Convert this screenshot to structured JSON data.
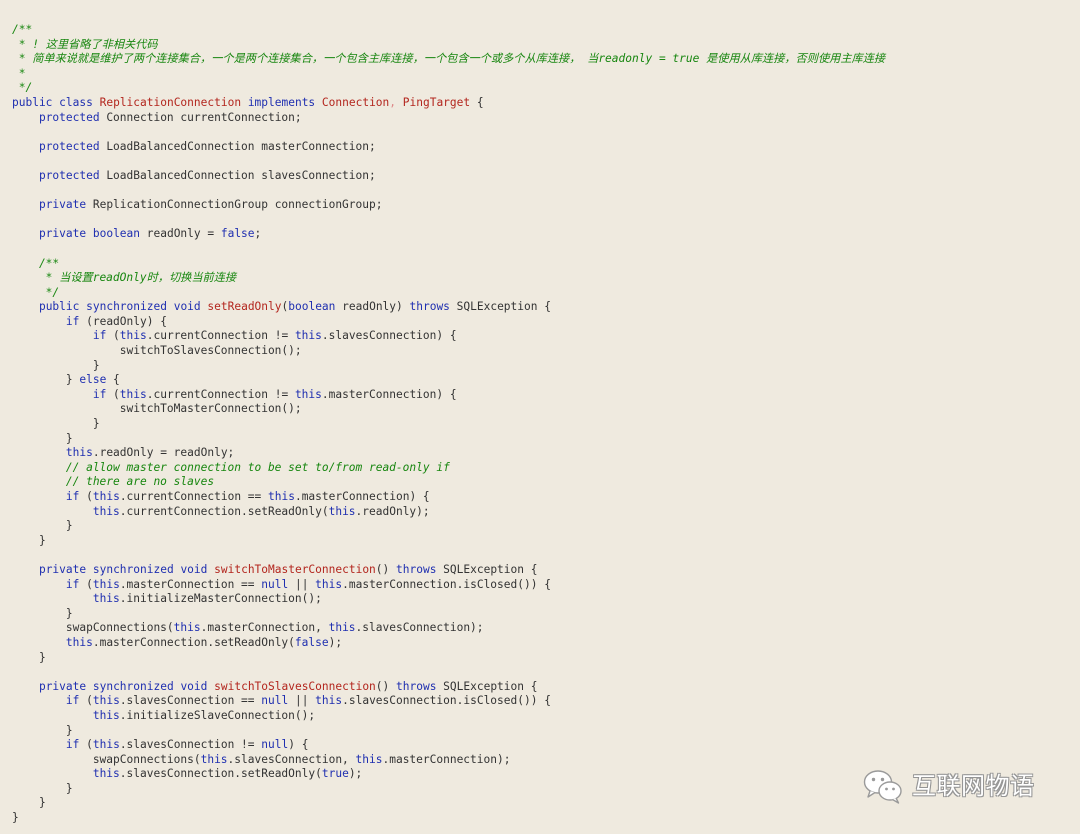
{
  "code": {
    "language": "java",
    "lines": [
      [
        {
          "t": "/**",
          "c": "comment"
        }
      ],
      [
        {
          "t": " * ! 这里省略了非相关代码",
          "c": "comment"
        }
      ],
      [
        {
          "t": " * 简单来说就是维护了两个连接集合，一个是两个连接集合，一个包含主库连接，一个包含一个或多个从库连接， 当readonly = true 是使用从库连接，否则使用主库连接",
          "c": "comment"
        }
      ],
      [
        {
          "t": " *",
          "c": "comment"
        }
      ],
      [
        {
          "t": " */",
          "c": "comment"
        }
      ],
      [
        {
          "t": "public",
          "c": "kw"
        },
        {
          "t": " ",
          "c": "plain"
        },
        {
          "t": "class",
          "c": "kw"
        },
        {
          "t": " ",
          "c": "plain"
        },
        {
          "t": "ReplicationConnection",
          "c": "cls"
        },
        {
          "t": " ",
          "c": "plain"
        },
        {
          "t": "implements",
          "c": "kw"
        },
        {
          "t": " ",
          "c": "plain"
        },
        {
          "t": "Connection",
          "c": "cls"
        },
        {
          "t": ", ",
          "c": "op"
        },
        {
          "t": "PingTarget",
          "c": "cls"
        },
        {
          "t": " {",
          "c": "plain"
        }
      ],
      [
        {
          "t": "    ",
          "c": "plain"
        },
        {
          "t": "protected",
          "c": "kw"
        },
        {
          "t": " Connection currentConnection;",
          "c": "plain"
        }
      ],
      [
        {
          "t": "",
          "c": "plain"
        }
      ],
      [
        {
          "t": "    ",
          "c": "plain"
        },
        {
          "t": "protected",
          "c": "kw"
        },
        {
          "t": " LoadBalancedConnection masterConnection;",
          "c": "plain"
        }
      ],
      [
        {
          "t": "",
          "c": "plain"
        }
      ],
      [
        {
          "t": "    ",
          "c": "plain"
        },
        {
          "t": "protected",
          "c": "kw"
        },
        {
          "t": " LoadBalancedConnection slavesConnection;",
          "c": "plain"
        }
      ],
      [
        {
          "t": "",
          "c": "plain"
        }
      ],
      [
        {
          "t": "    ",
          "c": "plain"
        },
        {
          "t": "private",
          "c": "kw"
        },
        {
          "t": " ReplicationConnectionGroup connectionGroup;",
          "c": "plain"
        }
      ],
      [
        {
          "t": "",
          "c": "plain"
        }
      ],
      [
        {
          "t": "    ",
          "c": "plain"
        },
        {
          "t": "private",
          "c": "kw"
        },
        {
          "t": " ",
          "c": "plain"
        },
        {
          "t": "boolean",
          "c": "type"
        },
        {
          "t": " readOnly = ",
          "c": "plain"
        },
        {
          "t": "false",
          "c": "kw"
        },
        {
          "t": ";",
          "c": "plain"
        }
      ],
      [
        {
          "t": "",
          "c": "plain"
        }
      ],
      [
        {
          "t": "    /**",
          "c": "comment"
        }
      ],
      [
        {
          "t": "     * 当设置readOnly时，切换当前连接",
          "c": "comment"
        }
      ],
      [
        {
          "t": "     */",
          "c": "comment"
        }
      ],
      [
        {
          "t": "    ",
          "c": "plain"
        },
        {
          "t": "public",
          "c": "kw"
        },
        {
          "t": " ",
          "c": "plain"
        },
        {
          "t": "synchronized",
          "c": "kw"
        },
        {
          "t": " ",
          "c": "plain"
        },
        {
          "t": "void",
          "c": "type"
        },
        {
          "t": " ",
          "c": "plain"
        },
        {
          "t": "setReadOnly",
          "c": "fn"
        },
        {
          "t": "(",
          "c": "plain"
        },
        {
          "t": "boolean",
          "c": "type"
        },
        {
          "t": " readOnly) ",
          "c": "plain"
        },
        {
          "t": "throws",
          "c": "kw"
        },
        {
          "t": " SQLException {",
          "c": "plain"
        }
      ],
      [
        {
          "t": "        ",
          "c": "plain"
        },
        {
          "t": "if",
          "c": "kw"
        },
        {
          "t": " (readOnly) {",
          "c": "plain"
        }
      ],
      [
        {
          "t": "            ",
          "c": "plain"
        },
        {
          "t": "if",
          "c": "kw"
        },
        {
          "t": " (",
          "c": "plain"
        },
        {
          "t": "this",
          "c": "kw"
        },
        {
          "t": ".currentConnection != ",
          "c": "plain"
        },
        {
          "t": "this",
          "c": "kw"
        },
        {
          "t": ".slavesConnection) {",
          "c": "plain"
        }
      ],
      [
        {
          "t": "                switchToSlavesConnection();",
          "c": "plain"
        }
      ],
      [
        {
          "t": "            }",
          "c": "plain"
        }
      ],
      [
        {
          "t": "        } ",
          "c": "plain"
        },
        {
          "t": "else",
          "c": "kw"
        },
        {
          "t": " {",
          "c": "plain"
        }
      ],
      [
        {
          "t": "            ",
          "c": "plain"
        },
        {
          "t": "if",
          "c": "kw"
        },
        {
          "t": " (",
          "c": "plain"
        },
        {
          "t": "this",
          "c": "kw"
        },
        {
          "t": ".currentConnection != ",
          "c": "plain"
        },
        {
          "t": "this",
          "c": "kw"
        },
        {
          "t": ".masterConnection) {",
          "c": "plain"
        }
      ],
      [
        {
          "t": "                switchToMasterConnection();",
          "c": "plain"
        }
      ],
      [
        {
          "t": "            }",
          "c": "plain"
        }
      ],
      [
        {
          "t": "        }",
          "c": "plain"
        }
      ],
      [
        {
          "t": "        ",
          "c": "plain"
        },
        {
          "t": "this",
          "c": "kw"
        },
        {
          "t": ".readOnly = readOnly;",
          "c": "plain"
        }
      ],
      [
        {
          "t": "        // allow master connection to be set to/from read-only if",
          "c": "comment"
        }
      ],
      [
        {
          "t": "        // there are no slaves",
          "c": "comment"
        }
      ],
      [
        {
          "t": "        ",
          "c": "plain"
        },
        {
          "t": "if",
          "c": "kw"
        },
        {
          "t": " (",
          "c": "plain"
        },
        {
          "t": "this",
          "c": "kw"
        },
        {
          "t": ".currentConnection == ",
          "c": "plain"
        },
        {
          "t": "this",
          "c": "kw"
        },
        {
          "t": ".masterConnection) {",
          "c": "plain"
        }
      ],
      [
        {
          "t": "            ",
          "c": "plain"
        },
        {
          "t": "this",
          "c": "kw"
        },
        {
          "t": ".currentConnection.setReadOnly(",
          "c": "plain"
        },
        {
          "t": "this",
          "c": "kw"
        },
        {
          "t": ".readOnly);",
          "c": "plain"
        }
      ],
      [
        {
          "t": "        }",
          "c": "plain"
        }
      ],
      [
        {
          "t": "    }",
          "c": "plain"
        }
      ],
      [
        {
          "t": "",
          "c": "plain"
        }
      ],
      [
        {
          "t": "    ",
          "c": "plain"
        },
        {
          "t": "private",
          "c": "kw"
        },
        {
          "t": " ",
          "c": "plain"
        },
        {
          "t": "synchronized",
          "c": "kw"
        },
        {
          "t": " ",
          "c": "plain"
        },
        {
          "t": "void",
          "c": "type"
        },
        {
          "t": " ",
          "c": "plain"
        },
        {
          "t": "switchToMasterConnection",
          "c": "fn"
        },
        {
          "t": "() ",
          "c": "plain"
        },
        {
          "t": "throws",
          "c": "kw"
        },
        {
          "t": " SQLException {",
          "c": "plain"
        }
      ],
      [
        {
          "t": "        ",
          "c": "plain"
        },
        {
          "t": "if",
          "c": "kw"
        },
        {
          "t": " (",
          "c": "plain"
        },
        {
          "t": "this",
          "c": "kw"
        },
        {
          "t": ".masterConnection == ",
          "c": "plain"
        },
        {
          "t": "null",
          "c": "kw"
        },
        {
          "t": " || ",
          "c": "plain"
        },
        {
          "t": "this",
          "c": "kw"
        },
        {
          "t": ".masterConnection.isClosed()) {",
          "c": "plain"
        }
      ],
      [
        {
          "t": "            ",
          "c": "plain"
        },
        {
          "t": "this",
          "c": "kw"
        },
        {
          "t": ".initializeMasterConnection();",
          "c": "plain"
        }
      ],
      [
        {
          "t": "        }",
          "c": "plain"
        }
      ],
      [
        {
          "t": "        swapConnections(",
          "c": "plain"
        },
        {
          "t": "this",
          "c": "kw"
        },
        {
          "t": ".masterConnection, ",
          "c": "plain"
        },
        {
          "t": "this",
          "c": "kw"
        },
        {
          "t": ".slavesConnection);",
          "c": "plain"
        }
      ],
      [
        {
          "t": "        ",
          "c": "plain"
        },
        {
          "t": "this",
          "c": "kw"
        },
        {
          "t": ".masterConnection.setReadOnly(",
          "c": "plain"
        },
        {
          "t": "false",
          "c": "kw"
        },
        {
          "t": ");",
          "c": "plain"
        }
      ],
      [
        {
          "t": "    }",
          "c": "plain"
        }
      ],
      [
        {
          "t": "",
          "c": "plain"
        }
      ],
      [
        {
          "t": "    ",
          "c": "plain"
        },
        {
          "t": "private",
          "c": "kw"
        },
        {
          "t": " ",
          "c": "plain"
        },
        {
          "t": "synchronized",
          "c": "kw"
        },
        {
          "t": " ",
          "c": "plain"
        },
        {
          "t": "void",
          "c": "type"
        },
        {
          "t": " ",
          "c": "plain"
        },
        {
          "t": "switchToSlavesConnection",
          "c": "fn"
        },
        {
          "t": "() ",
          "c": "plain"
        },
        {
          "t": "throws",
          "c": "kw"
        },
        {
          "t": " SQLException {",
          "c": "plain"
        }
      ],
      [
        {
          "t": "        ",
          "c": "plain"
        },
        {
          "t": "if",
          "c": "kw"
        },
        {
          "t": " (",
          "c": "plain"
        },
        {
          "t": "this",
          "c": "kw"
        },
        {
          "t": ".slavesConnection == ",
          "c": "plain"
        },
        {
          "t": "null",
          "c": "kw"
        },
        {
          "t": " || ",
          "c": "plain"
        },
        {
          "t": "this",
          "c": "kw"
        },
        {
          "t": ".slavesConnection.isClosed()) {",
          "c": "plain"
        }
      ],
      [
        {
          "t": "            ",
          "c": "plain"
        },
        {
          "t": "this",
          "c": "kw"
        },
        {
          "t": ".initializeSlaveConnection();",
          "c": "plain"
        }
      ],
      [
        {
          "t": "        }",
          "c": "plain"
        }
      ],
      [
        {
          "t": "        ",
          "c": "plain"
        },
        {
          "t": "if",
          "c": "kw"
        },
        {
          "t": " (",
          "c": "plain"
        },
        {
          "t": "this",
          "c": "kw"
        },
        {
          "t": ".slavesConnection != ",
          "c": "plain"
        },
        {
          "t": "null",
          "c": "kw"
        },
        {
          "t": ") {",
          "c": "plain"
        }
      ],
      [
        {
          "t": "            swapConnections(",
          "c": "plain"
        },
        {
          "t": "this",
          "c": "kw"
        },
        {
          "t": ".slavesConnection, ",
          "c": "plain"
        },
        {
          "t": "this",
          "c": "kw"
        },
        {
          "t": ".masterConnection);",
          "c": "plain"
        }
      ],
      [
        {
          "t": "            ",
          "c": "plain"
        },
        {
          "t": "this",
          "c": "kw"
        },
        {
          "t": ".slavesConnection.setReadOnly(",
          "c": "plain"
        },
        {
          "t": "true",
          "c": "kw"
        },
        {
          "t": ");",
          "c": "plain"
        }
      ],
      [
        {
          "t": "        }",
          "c": "plain"
        }
      ],
      [
        {
          "t": "    }",
          "c": "plain"
        }
      ],
      [
        {
          "t": "}",
          "c": "plain"
        }
      ]
    ]
  },
  "watermark": {
    "icon": "wechat-icon",
    "text": "互联网物语"
  },
  "colors": {
    "background": "#efeadf",
    "keyword": "#1f2fb0",
    "class_name": "#b3261e",
    "comment": "#17860f",
    "plain": "#333333"
  }
}
